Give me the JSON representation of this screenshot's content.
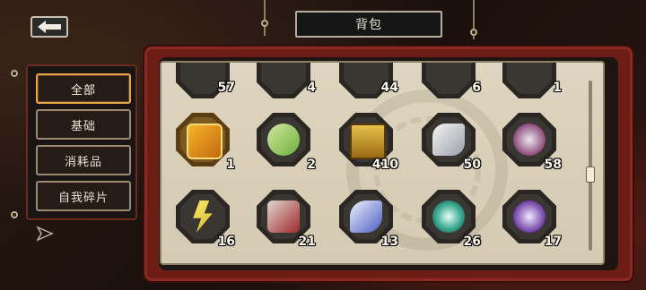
{
  "header": {
    "title": "背包"
  },
  "menu": {
    "items": [
      {
        "label": "全部",
        "active": true
      },
      {
        "label": "基础",
        "active": false
      },
      {
        "label": "消耗品",
        "active": false
      },
      {
        "label": "自我碎片",
        "active": false
      }
    ]
  },
  "inventory": {
    "row_top": [
      {
        "count": "57",
        "icon": "item-icon"
      },
      {
        "count": "4",
        "icon": "item-icon"
      },
      {
        "count": "44",
        "icon": "item-icon"
      },
      {
        "count": "6",
        "icon": "item-icon"
      },
      {
        "count": "1",
        "icon": "item-icon"
      }
    ],
    "row_middle": [
      {
        "count": "1",
        "icon": "gold-ticket-icon"
      },
      {
        "count": "2",
        "icon": "green-card-icon"
      },
      {
        "count": "410",
        "icon": "gold-chest-icon"
      },
      {
        "count": "50",
        "icon": "silver-shoe-icon"
      },
      {
        "count": "58",
        "icon": "purple-orb-icon"
      }
    ],
    "row_bottom": [
      {
        "count": "16",
        "icon": "yellow-bolt-icon"
      },
      {
        "count": "21",
        "icon": "red-mech-icon"
      },
      {
        "count": "13",
        "icon": "blue-tool-icon"
      },
      {
        "count": "26",
        "icon": "teal-ring-icon"
      },
      {
        "count": "17",
        "icon": "violet-shard-icon"
      }
    ]
  },
  "colors": {
    "accent": "#e6a34a",
    "frame": "#6e1d16",
    "panel": "#ded5c0"
  }
}
